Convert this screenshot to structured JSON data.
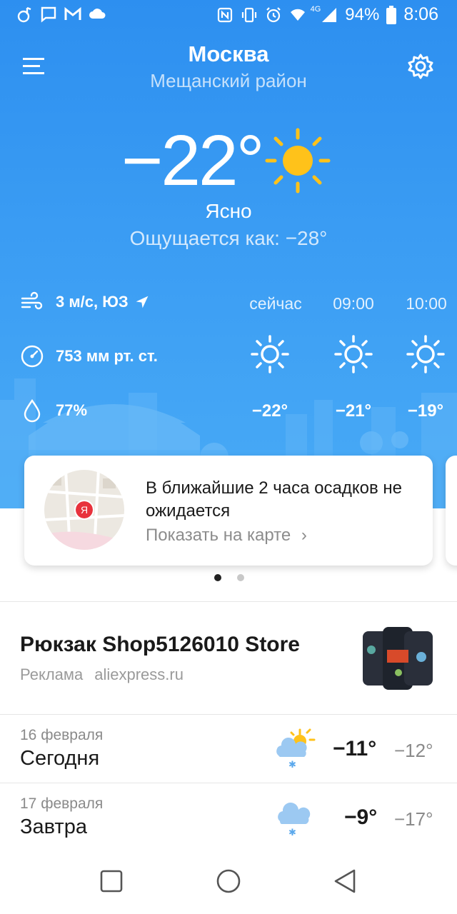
{
  "status_bar": {
    "battery": "94%",
    "time": "8:06",
    "network": "4G",
    "icons_left": [
      "music-icon",
      "message-icon",
      "gmail-icon",
      "cloud-icon"
    ],
    "icons_right": [
      "nfc-icon",
      "vibrate-icon",
      "alarm-icon",
      "wifi-icon",
      "signal-icon",
      "battery-icon"
    ]
  },
  "header": {
    "city": "Москва",
    "district": "Мещанский район"
  },
  "current": {
    "temperature": "−22°",
    "condition": "Ясно",
    "feels_like": "Ощущается как: −28°"
  },
  "stats": {
    "wind": "3 м/с, ЮЗ",
    "pressure": "753 мм рт. ст.",
    "humidity": "77%"
  },
  "hourly": [
    {
      "time": "сейчас",
      "temp": "−22°",
      "icon": "sun-icon"
    },
    {
      "time": "09:00",
      "temp": "−21°",
      "icon": "sun-icon"
    },
    {
      "time": "10:00",
      "temp": "−19°",
      "icon": "sun-icon"
    }
  ],
  "precip_card": {
    "title": "В ближайшие 2 часа осадков не ожидается",
    "link": "Показать на карте",
    "map_marker": "Я"
  },
  "ad": {
    "title": "Рюкзак Shop5126010 Store",
    "label": "Реклама",
    "domain": "aliexpress.ru"
  },
  "daily": [
    {
      "date": "16 февраля",
      "name": "Сегодня",
      "hi": "−11°",
      "lo": "−12°",
      "icon": "partly-cloudy-snow-icon"
    },
    {
      "date": "17 февраля",
      "name": "Завтра",
      "hi": "−9°",
      "lo": "−17°",
      "icon": "cloud-snow-icon"
    }
  ],
  "colors": {
    "sky": "#3a9cf3",
    "sun": "#ffc21a"
  }
}
